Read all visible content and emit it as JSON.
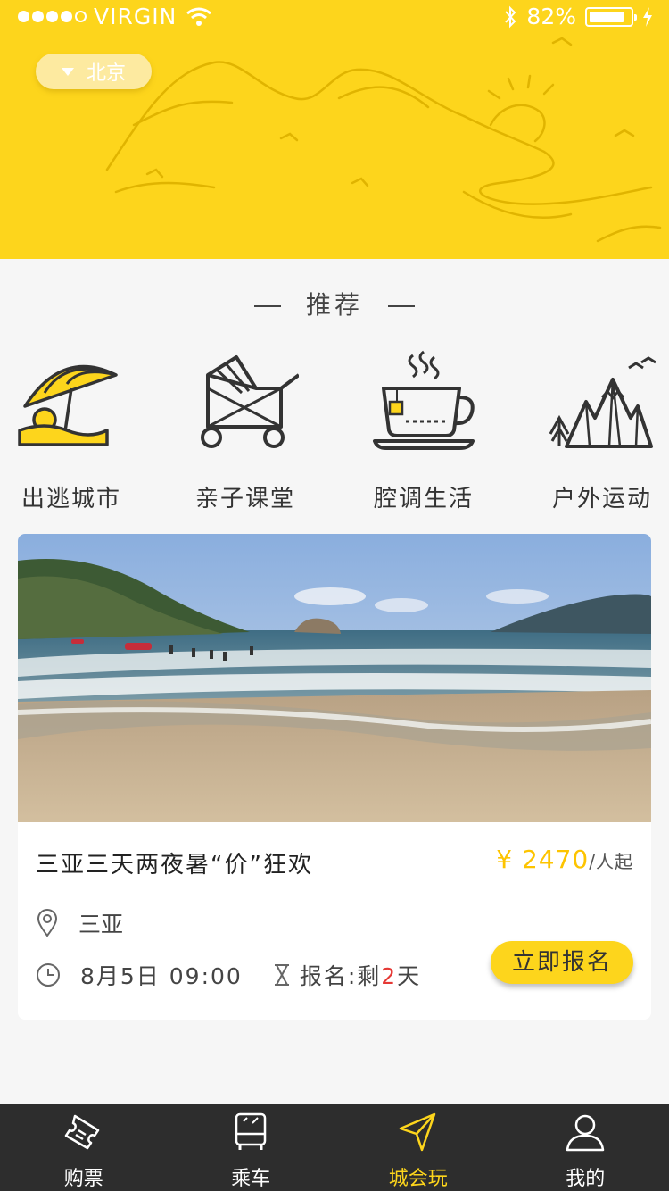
{
  "status_bar": {
    "carrier": "VIRGIN",
    "battery": "82%"
  },
  "header": {
    "city": "北京"
  },
  "section": {
    "title": "推荐"
  },
  "categories": [
    {
      "label": "出逃城市",
      "icon": "beach-umbrella-icon"
    },
    {
      "label": "亲子课堂",
      "icon": "stroller-icon"
    },
    {
      "label": "腔调生活",
      "icon": "coffee-cup-icon"
    },
    {
      "label": "户外运动",
      "icon": "mountains-icon"
    }
  ],
  "event_card": {
    "title": "三亚三天两夜暑“价”狂欢",
    "price_symbol": "¥",
    "price": "2470",
    "price_unit": "/人起",
    "location": "三亚",
    "datetime": "8月5日 09:00",
    "deadline_prefix": "报名:剩",
    "deadline_days": "2",
    "deadline_suffix": "天",
    "button_label": "立即报名"
  },
  "tabbar": {
    "items": [
      {
        "label": "购票",
        "icon": "ticket-icon"
      },
      {
        "label": "乘车",
        "icon": "bus-icon"
      },
      {
        "label": "城会玩",
        "icon": "paper-plane-icon",
        "active": true
      },
      {
        "label": "我的",
        "icon": "user-icon"
      }
    ]
  },
  "colors": {
    "brand_yellow": "#fdd51c",
    "price_yellow": "#fdc400",
    "tabbar_bg": "#2d2d2d",
    "highlight_red": "#e53935"
  }
}
